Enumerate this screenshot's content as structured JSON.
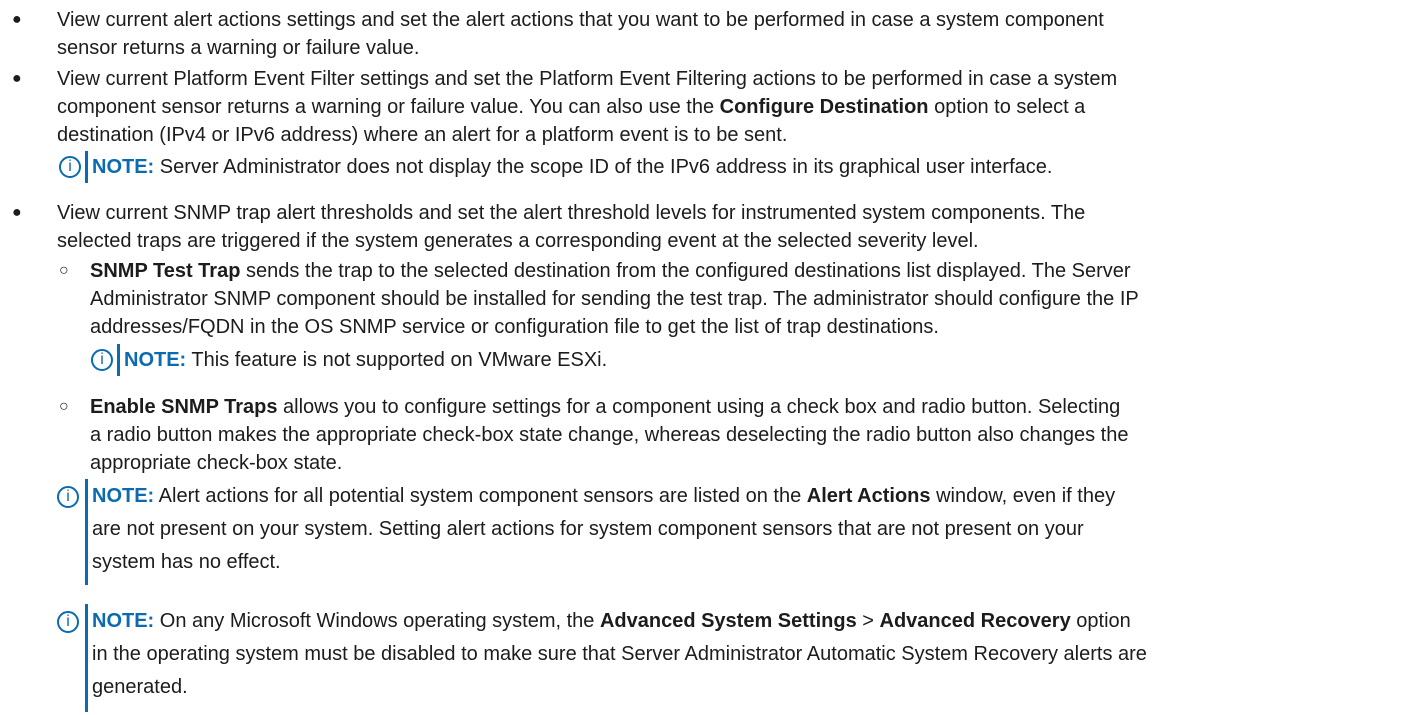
{
  "b1": {
    "l1": "View current alert actions settings and set the alert actions that you want to be performed in case a system component",
    "l2": "sensor returns a warning or failure value."
  },
  "b2": {
    "l1": "View current Platform Event Filter settings and set the Platform Event Filtering actions to be performed in case a system",
    "l2a": "component sensor returns a warning or failure value. You can also use the ",
    "l2b": "Configure Destination",
    "l2c": " option to select a",
    "l3": "destination (IPv4 or IPv6 address) where an alert for a platform event is to be sent."
  },
  "n1": {
    "label": "NOTE:",
    "text": " Server Administrator does not display the scope ID of the IPv6 address in its graphical user interface."
  },
  "b3": {
    "l1": "View current SNMP trap alert thresholds and set the alert threshold levels for instrumented system components. The",
    "l2": "selected traps are triggered if the system generates a corresponding event at the selected severity level."
  },
  "s1": {
    "bold": "SNMP Test Trap",
    "l1": " sends the trap to the selected destination from the configured destinations list displayed. The Server",
    "l2": "Administrator SNMP component should be installed for sending the test trap. The administrator should configure the IP",
    "l3": "addresses/FQDN in the OS SNMP service or configuration file to get the list of trap destinations."
  },
  "n2": {
    "label": "NOTE:",
    "text": " This feature is not supported on VMware ESXi."
  },
  "s2": {
    "bold": "Enable SNMP Traps",
    "l1": " allows you to configure settings for a component using a check box and radio button. Selecting",
    "l2": "a radio button makes the appropriate check-box state change, whereas deselecting the radio button also changes the",
    "l3": "appropriate check-box state."
  },
  "n3": {
    "label": "NOTE:",
    "l1a": " Alert actions for all potential system component sensors are listed on the ",
    "l1b": "Alert Actions",
    "l1c": " window, even if they",
    "l2": "are not present on your system. Setting alert actions for system component sensors that are not present on your",
    "l3": "system has no effect."
  },
  "n4": {
    "label": "NOTE:",
    "l1a": " On any Microsoft Windows operating system, the ",
    "l1b": "Advanced System Settings",
    "l1c": " > ",
    "l1d": "Advanced Recovery",
    "l1e": " option",
    "l2": "in the operating system must be disabled to make sure that Server Administrator Automatic System Recovery alerts are",
    "l3": "generated."
  },
  "symbols": {
    "bullet": "●",
    "sub_bullet": "○",
    "info_icon": "i"
  }
}
